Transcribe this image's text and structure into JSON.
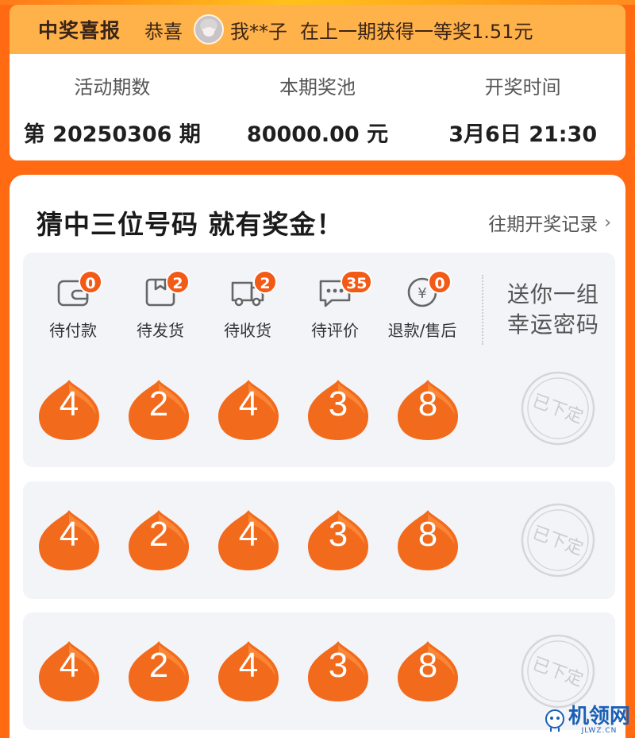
{
  "colors": {
    "brand_orange": "#ff6a13",
    "notice_bg": "#ffb24a",
    "ball": "#f26a1b",
    "badge": "#f25a16"
  },
  "notice": {
    "title": "中奖喜报",
    "prefix": "恭喜",
    "user": "我**子",
    "text": "在上一期获得一等奖1.51元"
  },
  "info": {
    "period_label": "活动期数",
    "period_value": "第 20250306 期",
    "pool_label": "本期奖池",
    "pool_value": "80000.00 元",
    "draw_label": "开奖时间",
    "draw_value": "3月6日 21:30"
  },
  "main": {
    "title": "猜中三位号码 就有奖金！",
    "history_label": "往期开奖记录"
  },
  "orders": [
    {
      "label": "待付款",
      "badge": "0",
      "icon": "wallet-icon"
    },
    {
      "label": "待发货",
      "badge": "2",
      "icon": "package-icon"
    },
    {
      "label": "待收货",
      "badge": "2",
      "icon": "truck-icon"
    },
    {
      "label": "待评价",
      "badge": "35",
      "icon": "comment-icon"
    },
    {
      "label": "退款/售后",
      "badge": "0",
      "icon": "refund-icon"
    }
  ],
  "gift_text": "送你一组幸运密码",
  "rows": [
    {
      "numbers": [
        "4",
        "2",
        "4",
        "3",
        "8"
      ],
      "stamp": "已下定"
    },
    {
      "numbers": [
        "4",
        "2",
        "4",
        "3",
        "8"
      ],
      "stamp": "已下定"
    },
    {
      "numbers": [
        "4",
        "2",
        "4",
        "3",
        "8"
      ],
      "stamp": "已下定"
    }
  ],
  "watermark": {
    "main": "机领网",
    "sub": "JLWZ.CN"
  }
}
